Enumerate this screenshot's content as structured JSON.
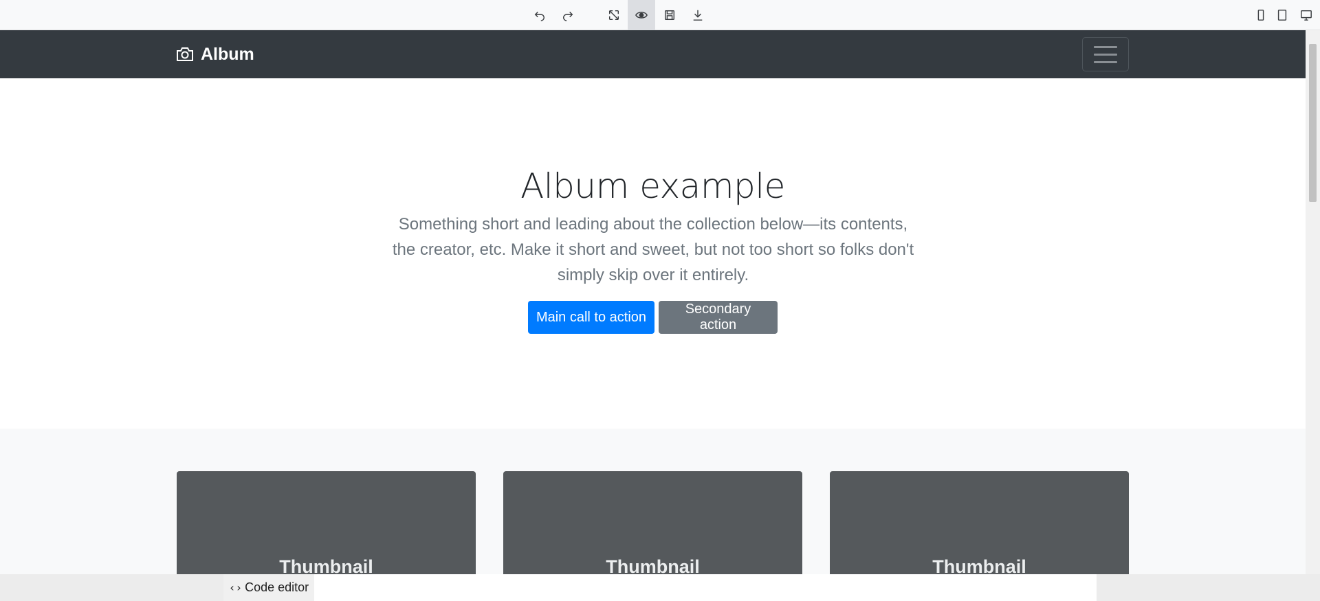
{
  "toolbar": {
    "icons": [
      "undo-icon",
      "redo-icon",
      "fullscreen-icon",
      "preview-icon",
      "save-icon",
      "download-icon",
      "mobile-icon",
      "tablet-icon",
      "desktop-icon"
    ]
  },
  "navbar": {
    "brand": "Album"
  },
  "hero": {
    "title": "Album example",
    "lead": "Something short and leading about the collection below—its contents, the creator, etc. Make it short and sweet, but not too short so folks don't simply skip over it entirely.",
    "primary_button": "Main call to action",
    "secondary_button": "Secondary action"
  },
  "cards": [
    {
      "label": "Thumbnail"
    },
    {
      "label": "Thumbnail"
    },
    {
      "label": "Thumbnail"
    }
  ],
  "bottom": {
    "code_editor_label": "Code editor"
  },
  "colors": {
    "navbar": "#343a40",
    "primary": "#007bff",
    "secondary": "#6c757d",
    "thumbnail": "#55595c"
  }
}
